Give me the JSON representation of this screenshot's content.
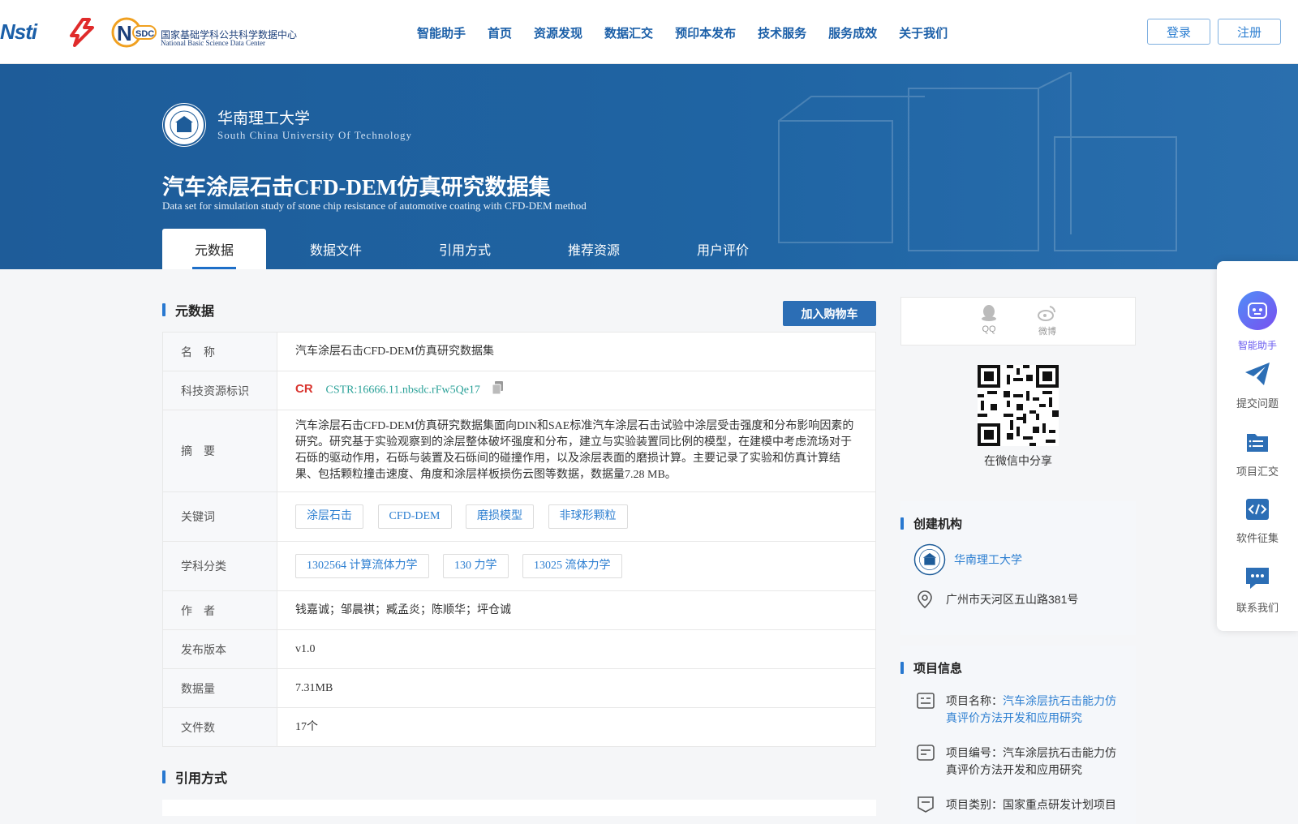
{
  "header": {
    "logo_cstr": "Nsti",
    "logo_nsdc_cn": "国家基础学科公共科学数据中心",
    "logo_nsdc_en": "National Basic Science Data Center",
    "nav": [
      "智能助手",
      "首页",
      "资源发现",
      "数据汇交",
      "预印本发布",
      "技术服务",
      "服务成效",
      "关于我们"
    ],
    "login": "登录",
    "register": "注册"
  },
  "hero": {
    "uni_cn": "华南理工大学",
    "uni_en": "South China University Of Technology",
    "title": "汽车涂层石击CFD-DEM仿真研究数据集",
    "subtitle": "Data set for simulation study of stone chip resistance of automotive coating with CFD-DEM method",
    "tabs": [
      "元数据",
      "数据文件",
      "引用方式",
      "推荐资源",
      "用户评价"
    ]
  },
  "metadata": {
    "section_title": "元数据",
    "cart_button": "加入购物车",
    "name_label": "名　称",
    "name_value": "汽车涂层石击CFD-DEM仿真研究数据集",
    "cstr_label": "科技资源标识",
    "cstr_value": "CSTR:16666.11.nbsdc.rFw5Qe17",
    "abstract_label": "摘　要",
    "abstract_value": "汽车涂层石击CFD-DEM仿真研究数据集面向DIN和SAE标准汽车涂层石击试验中涂层受击强度和分布影响因素的研究。研究基于实验观察到的涂层整体破坏强度和分布，建立与实验装置同比例的模型，在建模中考虑流场对于石砾的驱动作用，石砾与装置及石砾间的碰撞作用，以及涂层表面的磨损计算。主要记录了实验和仿真计算结果、包括颗粒撞击速度、角度和涂层样板损伤云图等数据，数据量7.28 MB。",
    "keywords_label": "关键词",
    "keywords": [
      "涂层石击",
      "CFD-DEM",
      "磨损模型",
      "非球形颗粒"
    ],
    "subject_label": "学科分类",
    "subjects": [
      "1302564 计算流体力学",
      "130 力学",
      "13025 流体力学"
    ],
    "author_label": "作　者",
    "authors": "钱嘉诚；邹晨祺；臧孟炎；陈顺华；坪仓诚",
    "version_label": "发布版本",
    "version": "v1.0",
    "size_label": "数据量",
    "size": "7.31MB",
    "files_label": "文件数",
    "files": "17个"
  },
  "citation": {
    "section_title": "引用方式"
  },
  "sidebar": {
    "share_qq": "QQ",
    "share_weibo": "微博",
    "wechat_share": "在微信中分享",
    "org_title": "创建机构",
    "org_name": "华南理工大学",
    "org_address": "广州市天河区五山路381号",
    "project_title": "项目信息",
    "project_name_label": "项目名称：",
    "project_name": "汽车涂层抗石击能力仿真评价方法开发和应用研究",
    "project_code_label": "项目编号：",
    "project_code": "汽车涂层抗石击能力仿真评价方法开发和应用研究",
    "project_type_label": "项目类别：",
    "project_type": "国家重点研发计划项目"
  },
  "float_bar": {
    "items": [
      "智能助手",
      "提交问题",
      "项目汇交",
      "软件征集",
      "联系我们"
    ]
  },
  "colors": {
    "brand_blue": "#1e5c99",
    "accent": "#2878d0",
    "link": "#2d7fd1",
    "assistant_purple": "#6a5cf0"
  }
}
